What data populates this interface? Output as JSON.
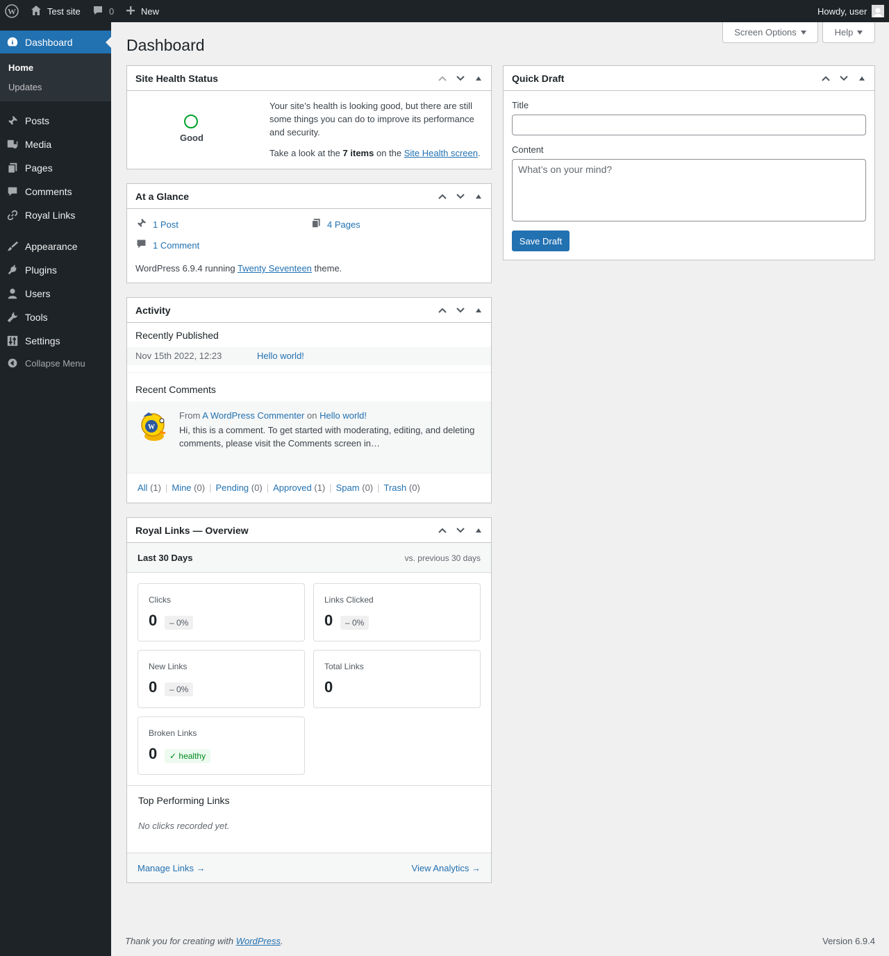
{
  "adminbar": {
    "site_name": "Test site",
    "comments_count": "0",
    "new_label": "New",
    "howdy": "Howdy, user"
  },
  "sidebar": {
    "dashboard": "Dashboard",
    "submenu": {
      "home": "Home",
      "updates": "Updates"
    },
    "items": [
      "Posts",
      "Media",
      "Pages",
      "Comments",
      "Royal Links",
      "Appearance",
      "Plugins",
      "Users",
      "Tools",
      "Settings"
    ],
    "collapse": "Collapse Menu"
  },
  "top_buttons": {
    "screen_options": "Screen Options",
    "help": "Help"
  },
  "page_title": "Dashboard",
  "site_health": {
    "title": "Site Health Status",
    "status": "Good",
    "text": "Your site’s health is looking good, but there are still some things you can do to improve its performance and security.",
    "look_prefix": "Take a look at the",
    "items": "7 items",
    "look_mid": "on the",
    "link": "Site Health screen",
    "look_suffix": "."
  },
  "glance": {
    "title": "At a Glance",
    "posts": "1 Post",
    "pages": "4 Pages",
    "comments": "1 Comment",
    "version_prefix": "WordPress 6.9.4 running",
    "theme": "Twenty Seventeen",
    "version_suffix": "theme."
  },
  "activity": {
    "title": "Activity",
    "recently_published": "Recently Published",
    "pub_date": "Nov 15th 2022, 12:23",
    "pub_title": "Hello world!",
    "recent_comments": "Recent Comments",
    "from": "From",
    "author": "A WordPress Commenter",
    "on": "on",
    "post": "Hello world!",
    "excerpt": "Hi, this is a comment. To get started with moderating, editing, and deleting comments, please visit the Comments screen in…",
    "filters": [
      {
        "label": "All",
        "count": "(1)"
      },
      {
        "label": "Mine",
        "count": "(0)"
      },
      {
        "label": "Pending",
        "count": "(0)"
      },
      {
        "label": "Approved",
        "count": "(1)"
      },
      {
        "label": "Spam",
        "count": "(0)"
      },
      {
        "label": "Trash",
        "count": "(0)"
      }
    ]
  },
  "royal": {
    "title": "Royal Links — Overview",
    "period": "Last 30 Days",
    "compare": "vs. previous 30 days",
    "cards": {
      "clicks": {
        "label": "Clicks",
        "value": "0",
        "badge": "– 0%"
      },
      "links_clicked": {
        "label": "Links Clicked",
        "value": "0",
        "badge": "– 0%"
      },
      "new_links": {
        "label": "New Links",
        "value": "0",
        "badge": "– 0%"
      },
      "total_links": {
        "label": "Total Links",
        "value": "0"
      },
      "broken_links": {
        "label": "Broken Links",
        "value": "0",
        "badge": "✓ healthy"
      }
    },
    "top_title": "Top Performing Links",
    "top_empty": "No clicks recorded yet.",
    "manage": "Manage Links →",
    "analytics": "View Analytics →"
  },
  "quick_draft": {
    "title": "Quick Draft",
    "title_label": "Title",
    "title_value": "",
    "content_label": "Content",
    "content_placeholder": "What’s on your mind?",
    "save": "Save Draft"
  },
  "footer": {
    "thanks_prefix": "Thank you for creating with",
    "wp": "WordPress",
    "thanks_suffix": ".",
    "version": "Version 6.9.4"
  },
  "colors": {
    "accent": "#2271b1",
    "admin_bg": "#1d2327",
    "healthy": "#008a20"
  }
}
